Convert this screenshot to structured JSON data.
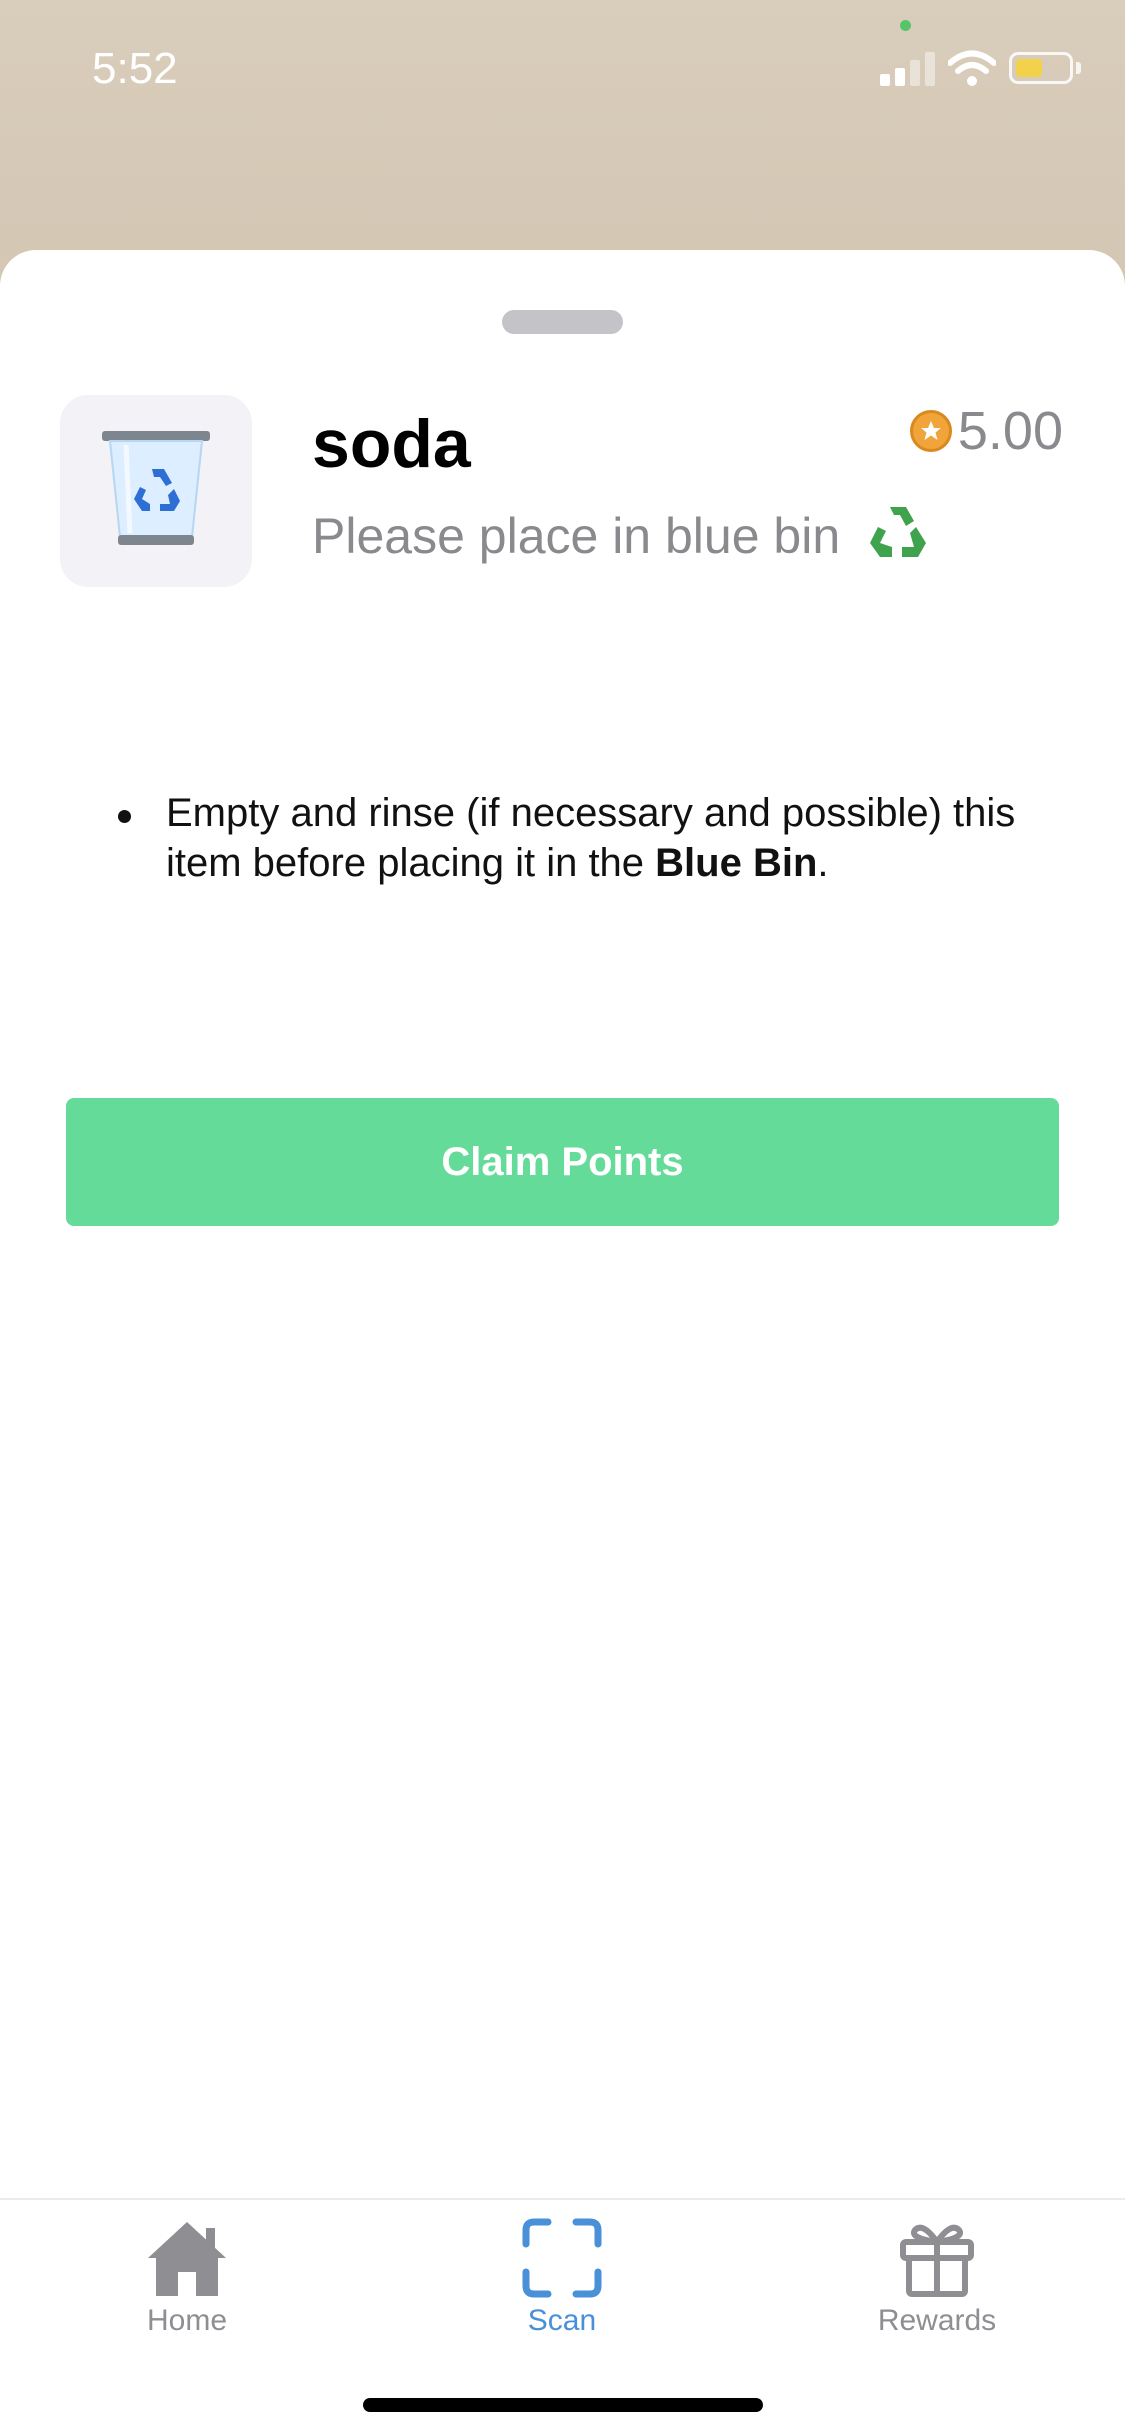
{
  "status_bar": {
    "time": "5:52",
    "battery_level": 0.45,
    "battery_color": "#f2d24b"
  },
  "item": {
    "title": "soda",
    "subtitle": "Please place in blue bin",
    "subtitle_icon": "recycle-icon",
    "thumbnail_icon": "recycle-bin-icon",
    "points": "5.00",
    "points_icon": "coin-icon"
  },
  "instructions": [
    {
      "text": "Empty and rinse (if necessary and possible) this item before placing it in the ",
      "bold": "Blue Bin",
      "suffix": "."
    }
  ],
  "claim_button": {
    "label": "Claim Points",
    "color": "#64db99"
  },
  "tab_bar": {
    "active": "Scan",
    "accent_color": "#4a90d9",
    "tabs": [
      {
        "label": "Home",
        "icon": "home-icon"
      },
      {
        "label": "Scan",
        "icon": "scan-icon"
      },
      {
        "label": "Rewards",
        "icon": "gift-icon"
      }
    ]
  }
}
